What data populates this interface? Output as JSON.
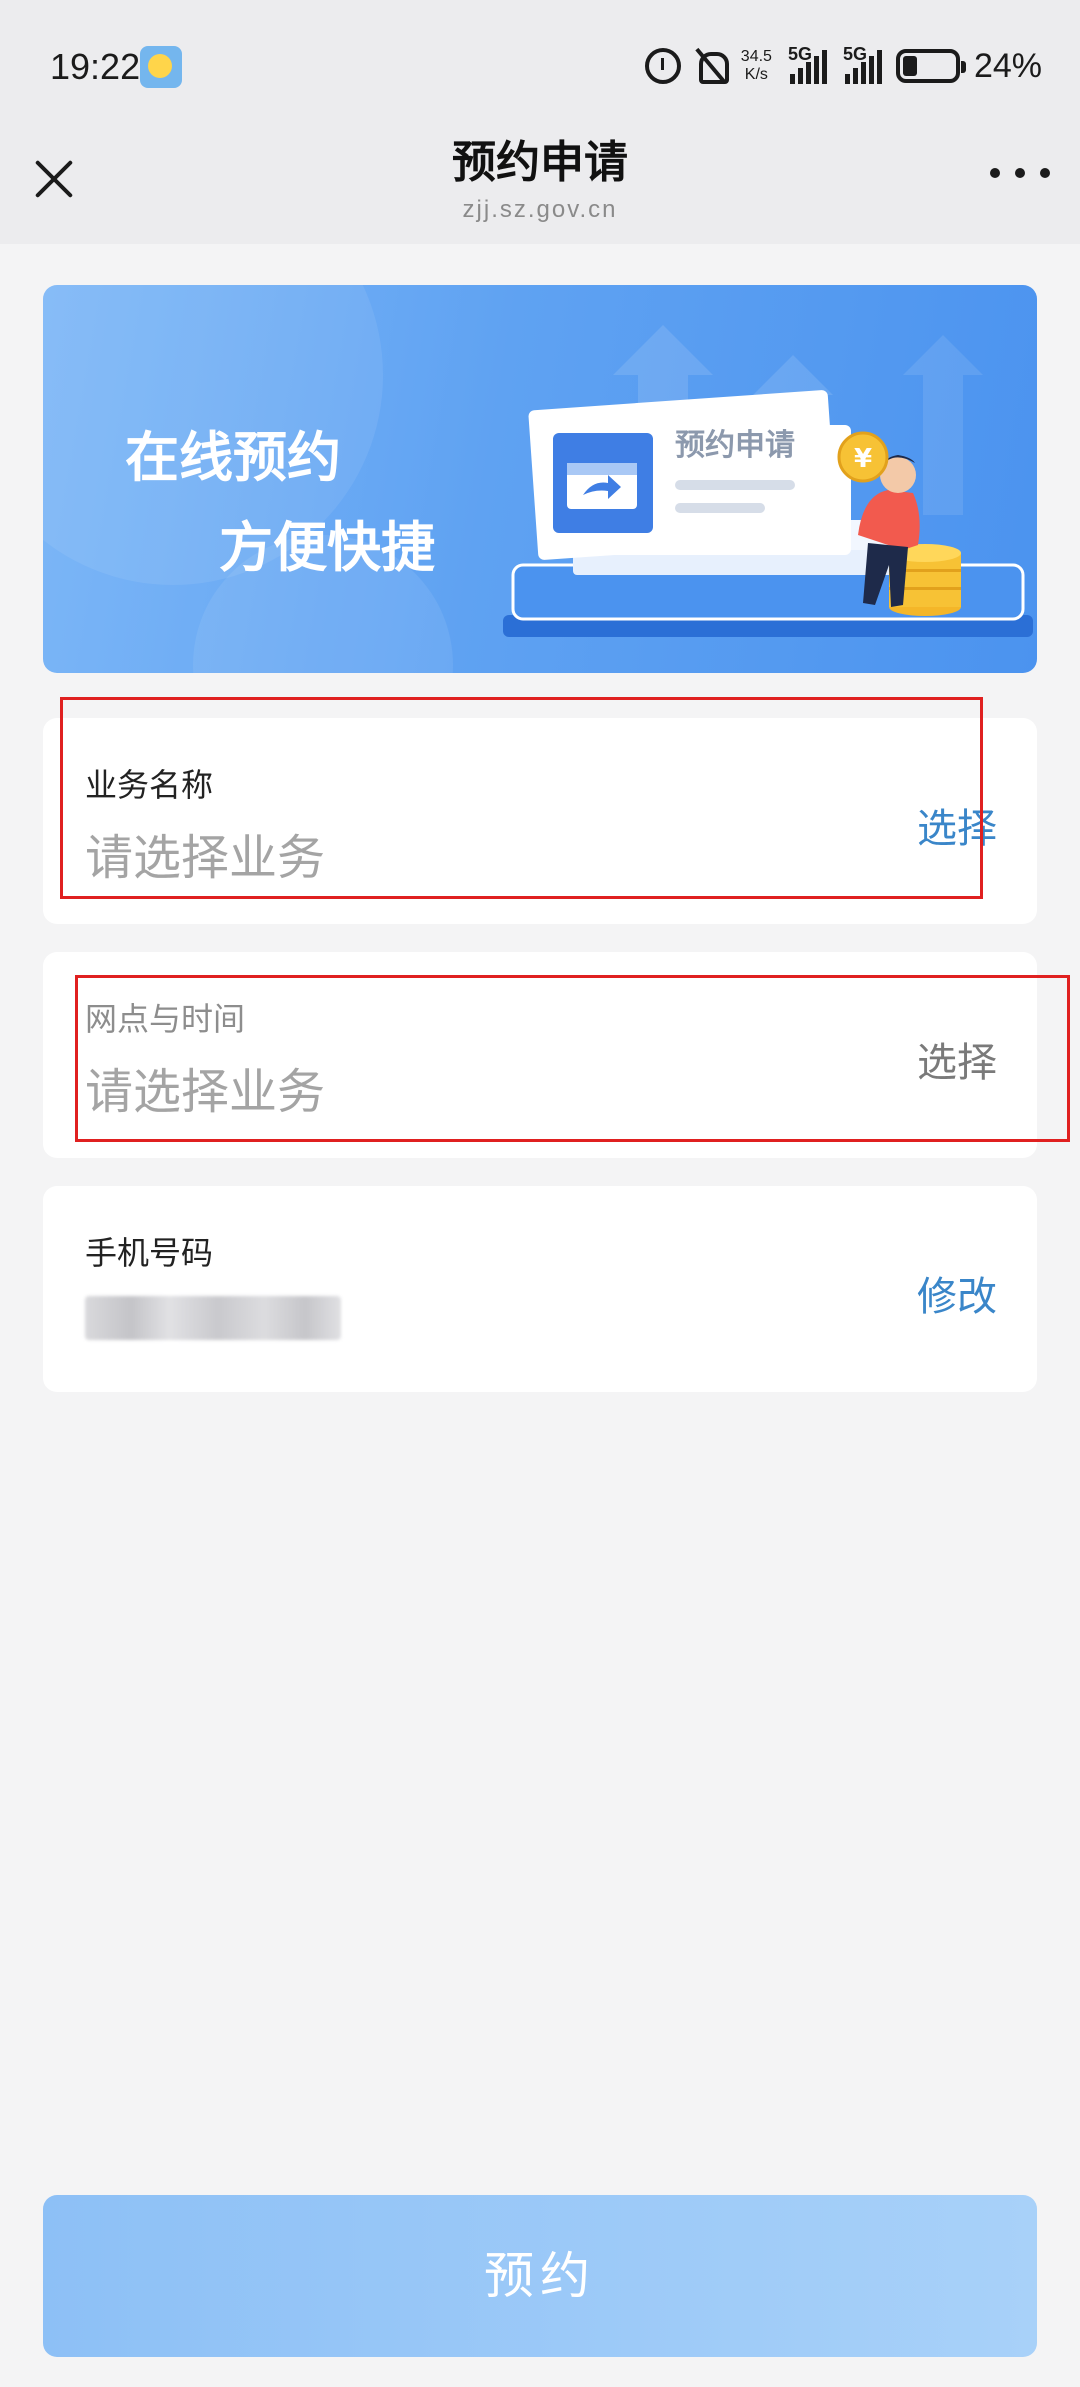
{
  "status_bar": {
    "time": "19:22",
    "net_speed_value": "34.5",
    "net_speed_unit": "K/s",
    "signal1_label": "5G",
    "signal2_label": "5G",
    "battery": "24%"
  },
  "nav": {
    "title": "预约申请",
    "subtitle": "zjj.sz.gov.cn"
  },
  "banner": {
    "line1": "在线预约",
    "line2": "方便快捷",
    "card_text": "预约申请"
  },
  "fields": {
    "business": {
      "label": "业务名称",
      "placeholder": "请选择业务",
      "action": "选择"
    },
    "branch_time": {
      "label": "网点与时间",
      "placeholder": "请选择业务",
      "action": "选择"
    },
    "phone": {
      "label": "手机号码",
      "action": "修改"
    }
  },
  "submit": {
    "label": "预约"
  },
  "colors": {
    "accent_blue": "#3a86c9",
    "highlight_red": "#e02020",
    "button_blue": "#9ac8f7"
  },
  "icons": [
    "weather-icon",
    "alarm-icon",
    "mute-icon",
    "close-icon",
    "more-icon",
    "yen-coin-icon"
  ]
}
